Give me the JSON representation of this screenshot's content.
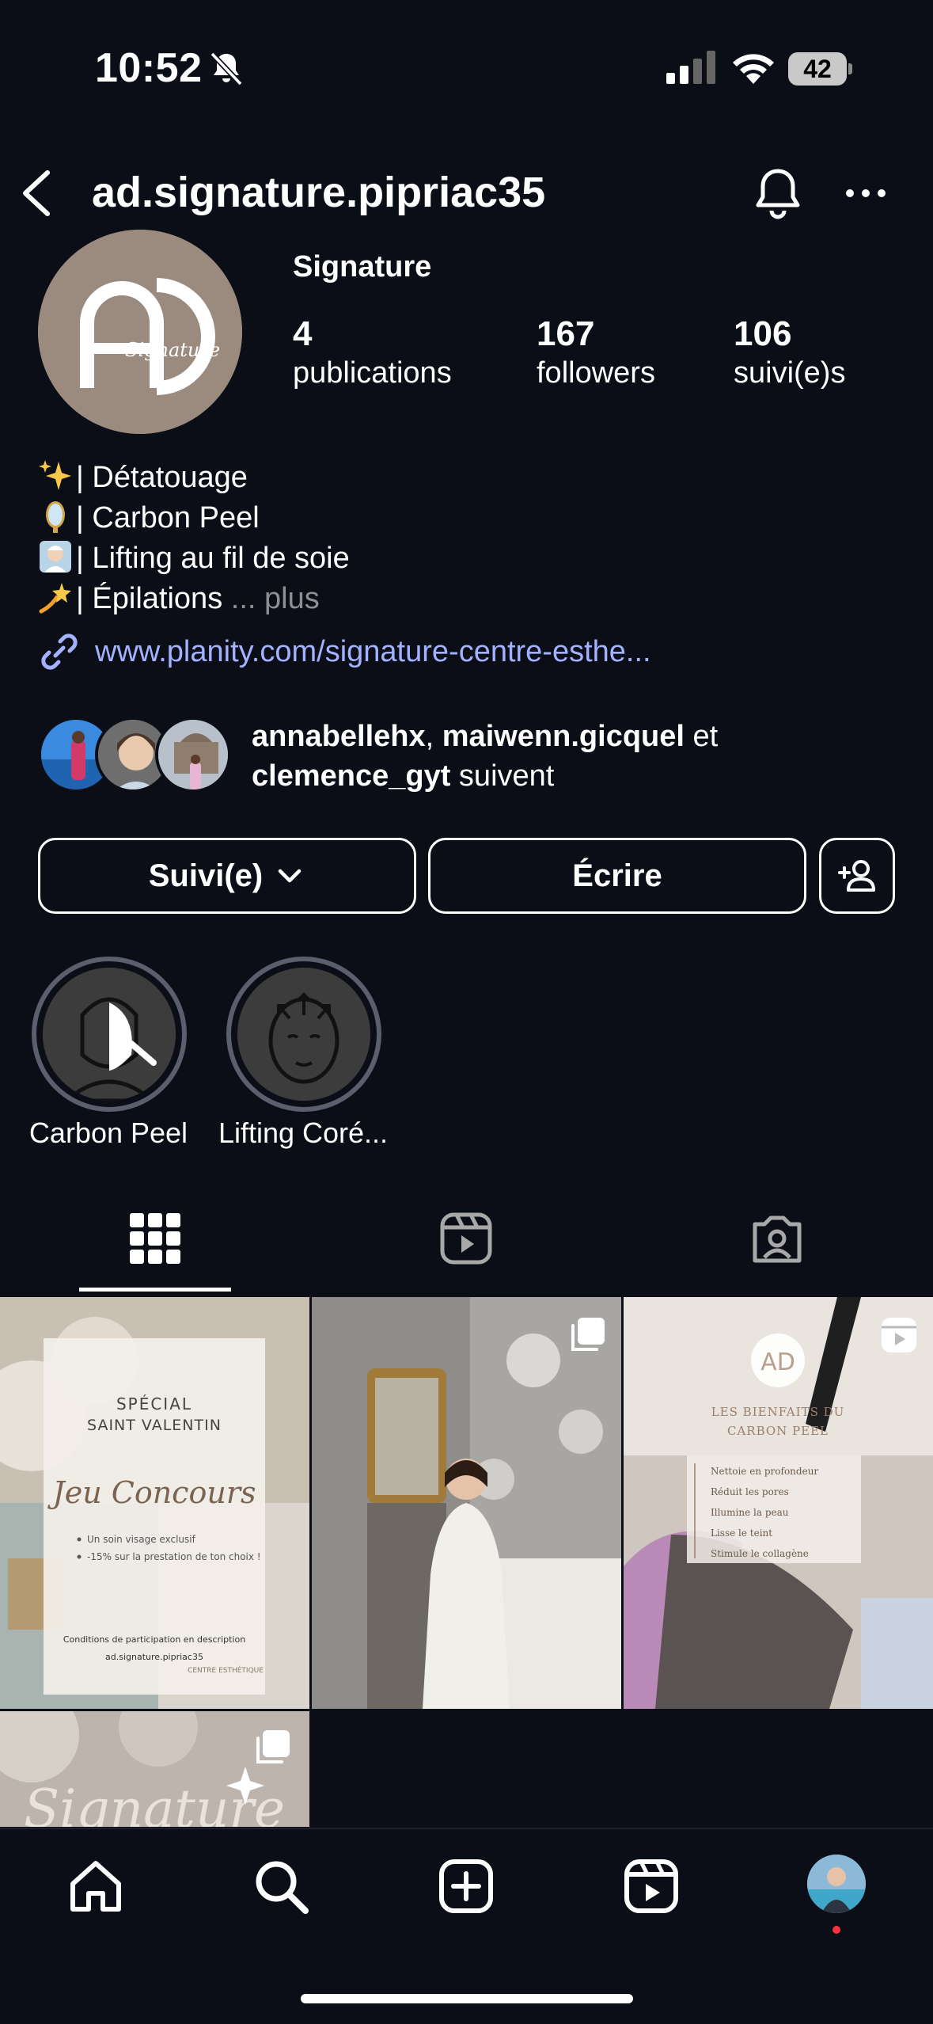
{
  "status_bar": {
    "time": "10:52",
    "battery": "42"
  },
  "header": {
    "handle": "ad.signature.pipriac35"
  },
  "profile": {
    "display_name": "Signature",
    "avatar_text": "Signature",
    "stats": [
      {
        "num": "4",
        "label": "publications"
      },
      {
        "num": "167",
        "label": "followers"
      },
      {
        "num": "106",
        "label": "suivi(e)s"
      }
    ],
    "bio": [
      "| Détatouage",
      "| Carbon Peel",
      "| Lifting au fil de soie",
      "| Épilations"
    ],
    "bio_more": "... plus",
    "link": "www.planity.com/signature-centre-esthe...",
    "mutual": {
      "names1": "annabellehx",
      "sep": ", ",
      "names2": "maiwenn.gicquel",
      "and": " et",
      "names3": "clemence_gyt",
      "suffix": " suivent"
    }
  },
  "buttons": {
    "follow": "Suivi(e)",
    "message": "Écrire"
  },
  "highlights": [
    {
      "label": "Carbon Peel"
    },
    {
      "label": "Lifting Coré..."
    }
  ],
  "posts": {
    "p1": {
      "title1": "SPÉCIAL",
      "title2": "SAINT VALENTIN",
      "script": "Jeu Concours",
      "bullet1": "Un soin visage exclusif",
      "bullet2": "-15% sur la prestation de ton choix !",
      "footer1": "Conditions de participation en description",
      "footer2": "ad.signature.pipriac35",
      "brand": "CENTRE ESTHÉTIQUE"
    },
    "p3": {
      "title1": "LES BIENFAITS DU",
      "title2": "CARBON PEEL",
      "items": [
        "Nettoie en profondeur",
        "Réduit les pores",
        "Illumine la peau",
        "Lisse le teint",
        "Stimule le collagène"
      ]
    },
    "p4": {
      "script": "Signature"
    }
  },
  "colors": {
    "background": "#0b0e17",
    "link": "#a3b2ff",
    "notif_dot": "#ff3040"
  }
}
